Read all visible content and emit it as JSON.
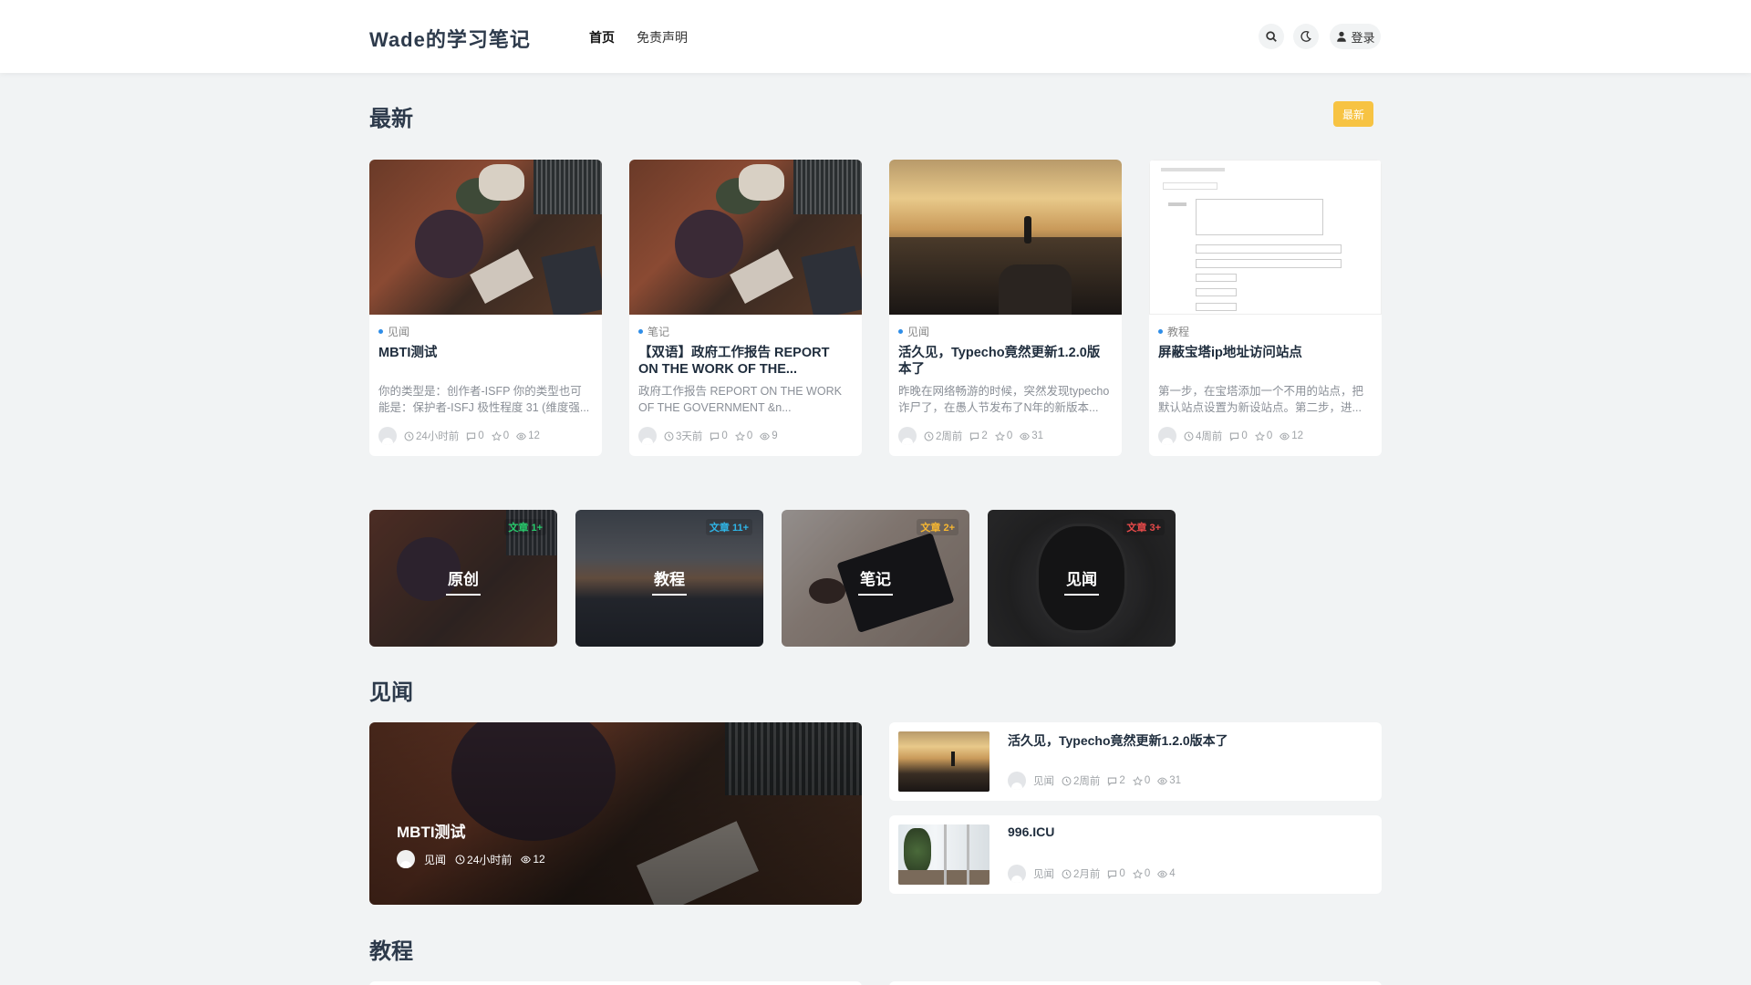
{
  "header": {
    "logo": "Wade的学习笔记",
    "nav": [
      "首页",
      "免责声明"
    ],
    "login": "登录"
  },
  "latest": {
    "title": "最新",
    "badge": "最新",
    "cards": [
      {
        "category": "见闻",
        "title": "MBTI测试",
        "excerpt": "你的类型是：创作者-ISFP 你的类型也可能是：保护者-ISFJ 极性程度 31 (维度强...",
        "time": "24小时前",
        "comments": "0",
        "stars": "0",
        "views": "12"
      },
      {
        "category": "笔记",
        "title": "【双语】政府工作报告 REPORT ON THE WORK OF THE...",
        "excerpt": "政府工作报告 REPORT ON THE WORK OF THE GOVERNMENT &n...",
        "time": "3天前",
        "comments": "0",
        "stars": "0",
        "views": "9"
      },
      {
        "category": "见闻",
        "title": "活久见，Typecho竟然更新1.2.0版本了",
        "excerpt": "昨晚在网络畅游的时候，突然发现typecho诈尸了，在愚人节发布了N年的新版本...",
        "time": "2周前",
        "comments": "2",
        "stars": "0",
        "views": "31"
      },
      {
        "category": "教程",
        "title": "屏蔽宝塔ip地址访问站点",
        "excerpt": "第一步，在宝塔添加一个不用的站点，把默认站点设置为新设站点。第二步，进...",
        "time": "4周前",
        "comments": "0",
        "stars": "0",
        "views": "12"
      }
    ]
  },
  "categories": [
    {
      "name": "原创",
      "badge": "文章 1+",
      "badge_color": "#27c96b"
    },
    {
      "name": "教程",
      "badge": "文章 11+",
      "badge_color": "#2fb6e8"
    },
    {
      "name": "笔记",
      "badge": "文章 2+",
      "badge_color": "#f7b731"
    },
    {
      "name": "见闻",
      "badge": "文章 3+",
      "badge_color": "#e84a4a"
    }
  ],
  "news": {
    "title": "见闻",
    "feature": {
      "title": "MBTI测试",
      "category": "见闻",
      "time": "24小时前",
      "views": "12"
    },
    "list": [
      {
        "title": "活久见，Typecho竟然更新1.2.0版本了",
        "category": "见闻",
        "time": "2周前",
        "comments": "2",
        "stars": "0",
        "views": "31"
      },
      {
        "title": "996.ICU",
        "category": "见闻",
        "time": "2月前",
        "comments": "0",
        "stars": "0",
        "views": "4"
      }
    ]
  },
  "tutorial": {
    "title": "教程"
  },
  "colors": {
    "accent_dot": "#2f8ee8",
    "badge_new": "#f7c343"
  }
}
